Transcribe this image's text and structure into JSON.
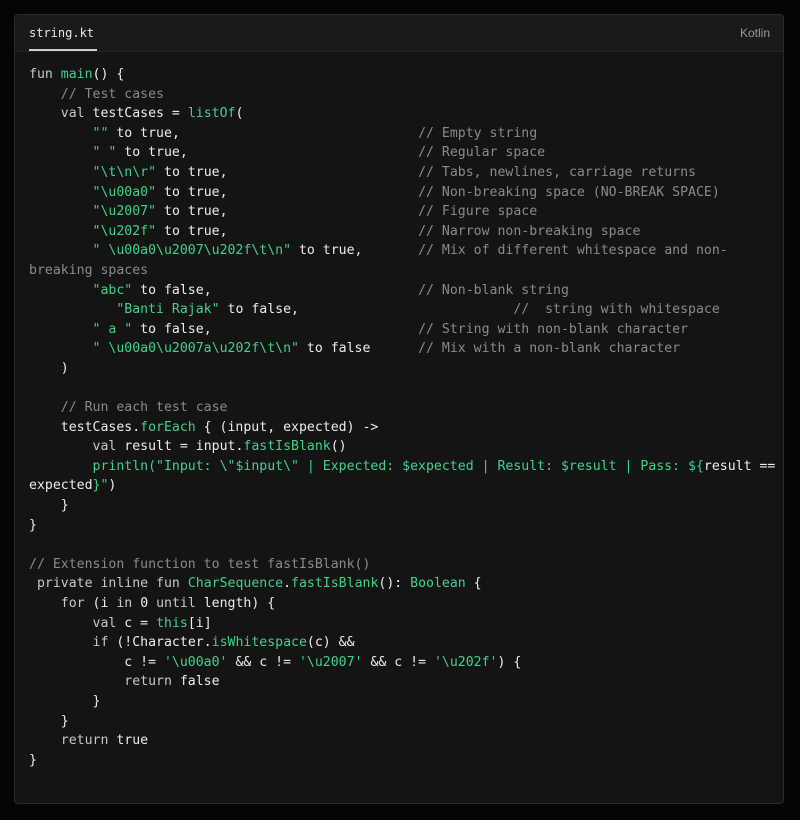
{
  "header": {
    "filename": "string.kt",
    "language": "Kotlin"
  },
  "code": {
    "lines": [
      [
        {
          "t": "kw",
          "v": "fun "
        },
        {
          "t": "fn",
          "v": "main"
        },
        {
          "t": "plain",
          "v": "() {"
        }
      ],
      [
        {
          "t": "plain",
          "v": "    "
        },
        {
          "t": "com",
          "v": "// Test cases"
        }
      ],
      [
        {
          "t": "plain",
          "v": "    "
        },
        {
          "t": "kw",
          "v": "val "
        },
        {
          "t": "plain",
          "v": "testCases = "
        },
        {
          "t": "fn",
          "v": "listOf"
        },
        {
          "t": "plain",
          "v": "("
        }
      ],
      [
        {
          "t": "plain",
          "v": "        "
        },
        {
          "t": "str",
          "v": "\"\""
        },
        {
          "t": "plain",
          "v": " to true,"
        },
        {
          "t": "plain",
          "v": "                              "
        },
        {
          "t": "com",
          "v": "// Empty string"
        }
      ],
      [
        {
          "t": "plain",
          "v": "        "
        },
        {
          "t": "str",
          "v": "\" \""
        },
        {
          "t": "plain",
          "v": " to true,"
        },
        {
          "t": "plain",
          "v": "                             "
        },
        {
          "t": "com",
          "v": "// Regular space"
        }
      ],
      [
        {
          "t": "plain",
          "v": "        "
        },
        {
          "t": "str",
          "v": "\"\\t\\n\\r\""
        },
        {
          "t": "plain",
          "v": " to true,"
        },
        {
          "t": "plain",
          "v": "                        "
        },
        {
          "t": "com",
          "v": "// Tabs, newlines, carriage returns"
        }
      ],
      [
        {
          "t": "plain",
          "v": "        "
        },
        {
          "t": "str",
          "v": "\"\\u00a0\""
        },
        {
          "t": "plain",
          "v": " to true,"
        },
        {
          "t": "plain",
          "v": "                        "
        },
        {
          "t": "com",
          "v": "// Non-breaking space (NO-BREAK SPACE)"
        }
      ],
      [
        {
          "t": "plain",
          "v": "        "
        },
        {
          "t": "str",
          "v": "\"\\u2007\""
        },
        {
          "t": "plain",
          "v": " to true,"
        },
        {
          "t": "plain",
          "v": "                        "
        },
        {
          "t": "com",
          "v": "// Figure space"
        }
      ],
      [
        {
          "t": "plain",
          "v": "        "
        },
        {
          "t": "str",
          "v": "\"\\u202f\""
        },
        {
          "t": "plain",
          "v": " to true,"
        },
        {
          "t": "plain",
          "v": "                        "
        },
        {
          "t": "com",
          "v": "// Narrow non-breaking space"
        }
      ],
      [
        {
          "t": "plain",
          "v": "        "
        },
        {
          "t": "str",
          "v": "\" \\u00a0\\u2007\\u202f\\t\\n\""
        },
        {
          "t": "plain",
          "v": " to true,"
        },
        {
          "t": "plain",
          "v": "       "
        },
        {
          "t": "com",
          "v": "// Mix of different whitespace and non-"
        }
      ],
      [
        {
          "t": "com",
          "v": "breaking spaces"
        }
      ],
      [
        {
          "t": "plain",
          "v": "        "
        },
        {
          "t": "str",
          "v": "\"abc\""
        },
        {
          "t": "plain",
          "v": " to false,"
        },
        {
          "t": "plain",
          "v": "                          "
        },
        {
          "t": "com",
          "v": "// Non-blank string"
        }
      ],
      [
        {
          "t": "plain",
          "v": "           "
        },
        {
          "t": "str",
          "v": "\"Banti Rajak\""
        },
        {
          "t": "plain",
          "v": " to false,"
        },
        {
          "t": "plain",
          "v": "                           "
        },
        {
          "t": "com",
          "v": "//  string with whitespace"
        }
      ],
      [
        {
          "t": "plain",
          "v": "        "
        },
        {
          "t": "str",
          "v": "\" a \""
        },
        {
          "t": "plain",
          "v": " to false,"
        },
        {
          "t": "plain",
          "v": "                          "
        },
        {
          "t": "com",
          "v": "// String with non-blank character"
        }
      ],
      [
        {
          "t": "plain",
          "v": "        "
        },
        {
          "t": "str",
          "v": "\" \\u00a0\\u2007a\\u202f\\t\\n\""
        },
        {
          "t": "plain",
          "v": " to false"
        },
        {
          "t": "plain",
          "v": "      "
        },
        {
          "t": "com",
          "v": "// Mix with a non-blank character"
        }
      ],
      [
        {
          "t": "plain",
          "v": "    )"
        }
      ],
      [
        {
          "t": "plain",
          "v": ""
        }
      ],
      [
        {
          "t": "plain",
          "v": "    "
        },
        {
          "t": "com",
          "v": "// Run each test case"
        }
      ],
      [
        {
          "t": "plain",
          "v": "    testCases."
        },
        {
          "t": "fn",
          "v": "forEach"
        },
        {
          "t": "plain",
          "v": " { (input, expected) ->"
        }
      ],
      [
        {
          "t": "plain",
          "v": "        "
        },
        {
          "t": "kw",
          "v": "val "
        },
        {
          "t": "plain",
          "v": "result = input."
        },
        {
          "t": "fn",
          "v": "fastIsBlank"
        },
        {
          "t": "plain",
          "v": "()"
        }
      ],
      [
        {
          "t": "plain",
          "v": "        "
        },
        {
          "t": "fn",
          "v": "println"
        },
        {
          "t": "str",
          "v": "(\"Input: \\\"$input\\\" | Expected: $expected | Result: $result | Pass: ${"
        },
        {
          "t": "plain",
          "v": "result =="
        }
      ],
      [
        {
          "t": "plain",
          "v": "expected"
        },
        {
          "t": "str",
          "v": "}\""
        },
        {
          "t": "plain",
          "v": ")"
        }
      ],
      [
        {
          "t": "plain",
          "v": "    }"
        }
      ],
      [
        {
          "t": "plain",
          "v": "}"
        }
      ],
      [
        {
          "t": "plain",
          "v": ""
        }
      ],
      [
        {
          "t": "com",
          "v": "// Extension function to test fastIsBlank()"
        }
      ],
      [
        {
          "t": "plain",
          "v": " "
        },
        {
          "t": "kw",
          "v": "private inline fun "
        },
        {
          "t": "type",
          "v": "CharSequence"
        },
        {
          "t": "plain",
          "v": "."
        },
        {
          "t": "fn",
          "v": "fastIsBlank"
        },
        {
          "t": "plain",
          "v": "(): "
        },
        {
          "t": "type",
          "v": "Boolean"
        },
        {
          "t": "plain",
          "v": " {"
        }
      ],
      [
        {
          "t": "plain",
          "v": "    "
        },
        {
          "t": "kw",
          "v": "for "
        },
        {
          "t": "plain",
          "v": "(i "
        },
        {
          "t": "kw",
          "v": "in "
        },
        {
          "t": "plain",
          "v": "0 "
        },
        {
          "t": "kw",
          "v": "until "
        },
        {
          "t": "plain",
          "v": "length) {"
        }
      ],
      [
        {
          "t": "plain",
          "v": "        "
        },
        {
          "t": "kw",
          "v": "val "
        },
        {
          "t": "plain",
          "v": "c = "
        },
        {
          "t": "fn",
          "v": "this"
        },
        {
          "t": "plain",
          "v": "[i]"
        }
      ],
      [
        {
          "t": "plain",
          "v": "        "
        },
        {
          "t": "kw",
          "v": "if "
        },
        {
          "t": "plain",
          "v": "(!Character."
        },
        {
          "t": "fn",
          "v": "isWhitespace"
        },
        {
          "t": "plain",
          "v": "(c) &&"
        }
      ],
      [
        {
          "t": "plain",
          "v": "            c != "
        },
        {
          "t": "str",
          "v": "'\\u00a0'"
        },
        {
          "t": "plain",
          "v": " && c != "
        },
        {
          "t": "str",
          "v": "'\\u2007'"
        },
        {
          "t": "plain",
          "v": " && c != "
        },
        {
          "t": "str",
          "v": "'\\u202f'"
        },
        {
          "t": "plain",
          "v": ") {"
        }
      ],
      [
        {
          "t": "plain",
          "v": "            "
        },
        {
          "t": "kw",
          "v": "return "
        },
        {
          "t": "plain",
          "v": "false"
        }
      ],
      [
        {
          "t": "plain",
          "v": "        }"
        }
      ],
      [
        {
          "t": "plain",
          "v": "    }"
        }
      ],
      [
        {
          "t": "plain",
          "v": "    "
        },
        {
          "t": "kw",
          "v": "return "
        },
        {
          "t": "plain",
          "v": "true"
        }
      ],
      [
        {
          "t": "plain",
          "v": "}"
        }
      ]
    ]
  }
}
